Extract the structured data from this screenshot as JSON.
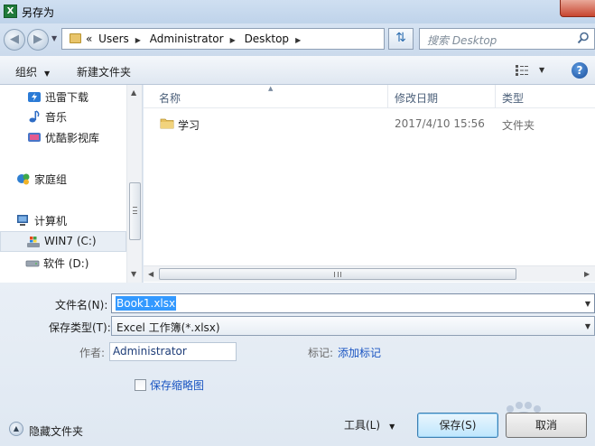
{
  "window": {
    "title": "另存为"
  },
  "address": {
    "crumb_prefix": "«",
    "crumbs": [
      "Users",
      "Administrator",
      "Desktop"
    ],
    "search_placeholder": "搜索 Desktop"
  },
  "toolbar": {
    "organize": "组织",
    "new_folder": "新建文件夹"
  },
  "nav": {
    "items": [
      {
        "label": "迅雷下载",
        "icon": "thunder-download-icon"
      },
      {
        "label": "音乐",
        "icon": "music-icon"
      },
      {
        "label": "优酷影视库",
        "icon": "youku-library-icon"
      },
      {
        "label": "家庭组",
        "icon": "homegroup-icon"
      },
      {
        "label": "计算机",
        "icon": "computer-icon"
      },
      {
        "label": "WIN7 (C:)",
        "icon": "windows-drive-icon"
      },
      {
        "label": "软件 (D:)",
        "icon": "drive-icon"
      }
    ]
  },
  "files": {
    "columns": {
      "name": "名称",
      "date": "修改日期",
      "type": "类型"
    },
    "rows": [
      {
        "name": "学习",
        "date": "2017/4/10 15:56",
        "type": "文件夹"
      }
    ]
  },
  "form": {
    "filename_label": "文件名(N):",
    "filename_value": "Book1.xlsx",
    "filetype_label": "保存类型(T):",
    "filetype_value": "Excel 工作簿(*.xlsx)",
    "author_label": "作者:",
    "author_value": "Administrator",
    "tags_label": "标记:",
    "tags_link": "添加标记",
    "thumbnail_label": "保存缩略图",
    "hide_folders": "隐藏文件夹",
    "tools": "工具(L)",
    "save": "保存(S)",
    "cancel": "取消"
  },
  "colors": {
    "accent": "#3399ff",
    "link": "#1a55c2",
    "close": "#c7452f"
  }
}
